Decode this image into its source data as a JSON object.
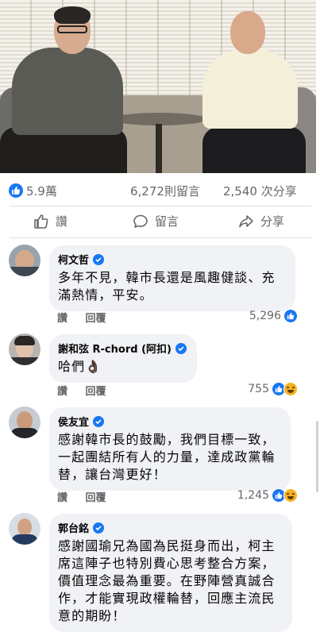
{
  "post": {
    "likes": "5.9萬",
    "comments": "6,272則留言",
    "shares": "2,540 次分享"
  },
  "actions": {
    "like": "讚",
    "comment": "留言",
    "share": "分享"
  },
  "comments": [
    {
      "name": "柯文哲",
      "text": "多年不見，韓市長還是風趣健談、充滿熱情，平安。",
      "like_label": "讚",
      "reply_label": "回覆",
      "reactions": "5,296"
    },
    {
      "name": "謝和弦 R-chord (阿扣)",
      "text": "哈們👌🏿",
      "like_label": "讚",
      "reply_label": "回覆",
      "reactions": "755"
    },
    {
      "name": "侯友宜",
      "text": "感謝韓市長的鼓勵，我們目標一致，一起團結所有人的力量，達成政黨輪替，讓台灣更好！",
      "like_label": "讚",
      "reply_label": "回覆",
      "reactions": "1,245"
    },
    {
      "name": "郭台銘",
      "text": "感謝國瑜兄為國為民挺身而出，柯主席這陣子也特別費心思考整合方案，價值理念最為重要。在野陣營真誠合作，才能實現政權輪替，回應主流民意的期盼！"
    }
  ],
  "colors": {
    "accent": "#1877f2",
    "bubble": "#f0f2f5",
    "meta": "#65676b"
  }
}
